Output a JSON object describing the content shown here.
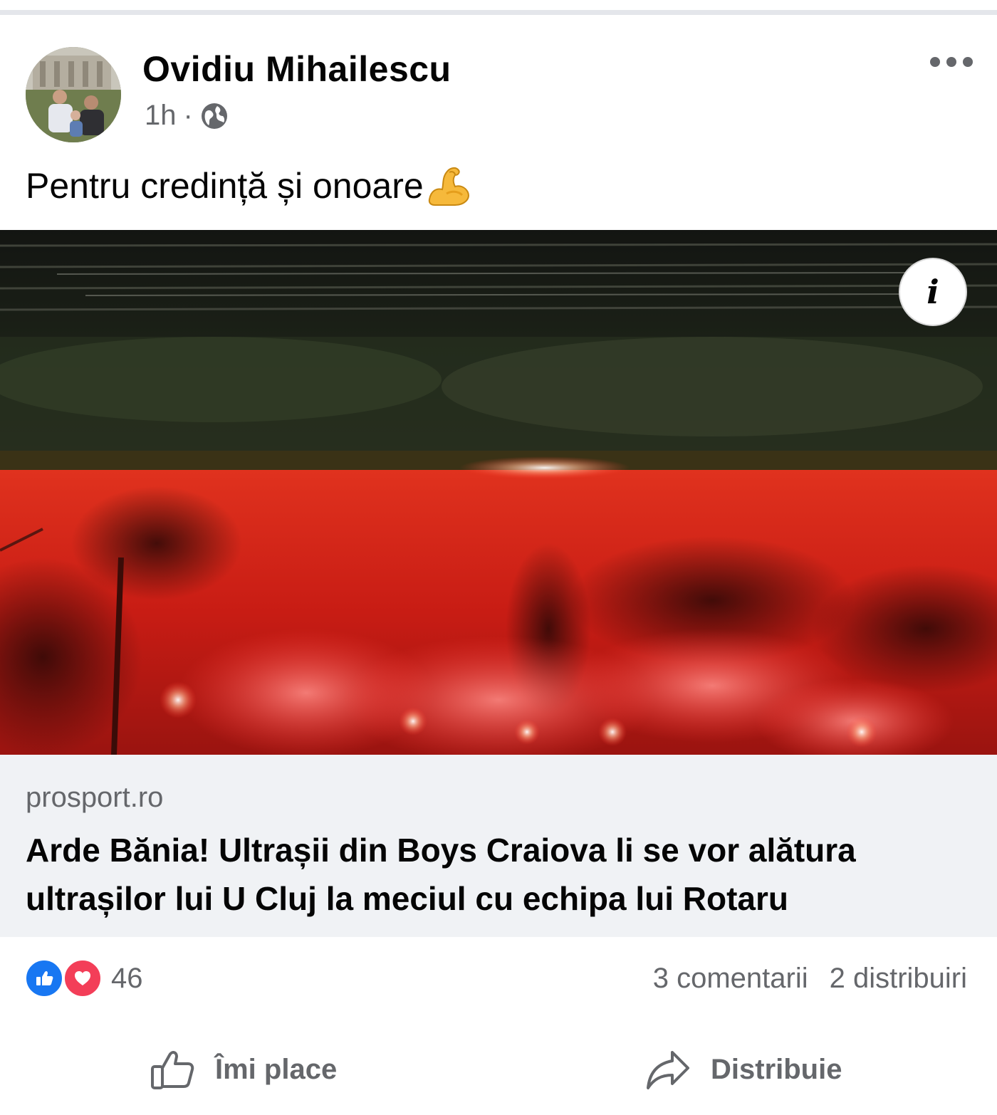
{
  "post": {
    "author": "Ovidiu Mihailescu",
    "time": "1h",
    "separator": "·",
    "privacy_icon": "globe-icon",
    "caption": "Pentru credință și onoare",
    "caption_emoji": "flexed-biceps",
    "more_icon": "more-horizontal-icon"
  },
  "link": {
    "domain": "prosport.ro",
    "title": "Arde Bănia! Ultrașii din Boys Craiova li se vor alătura ultrașilor lui U Cluj la meciul cu echipa lui Rotaru",
    "info_icon": "i"
  },
  "stats": {
    "reaction_count": "46",
    "comments": "3 comentarii",
    "shares": "2 distribuiri"
  },
  "actions": {
    "like_label": "Îmi place",
    "share_label": "Distribuie"
  },
  "colors": {
    "like_blue": "#1877f2",
    "love_red": "#f33e58",
    "secondary_text": "#65676b",
    "link_bg": "#f0f2f5"
  }
}
